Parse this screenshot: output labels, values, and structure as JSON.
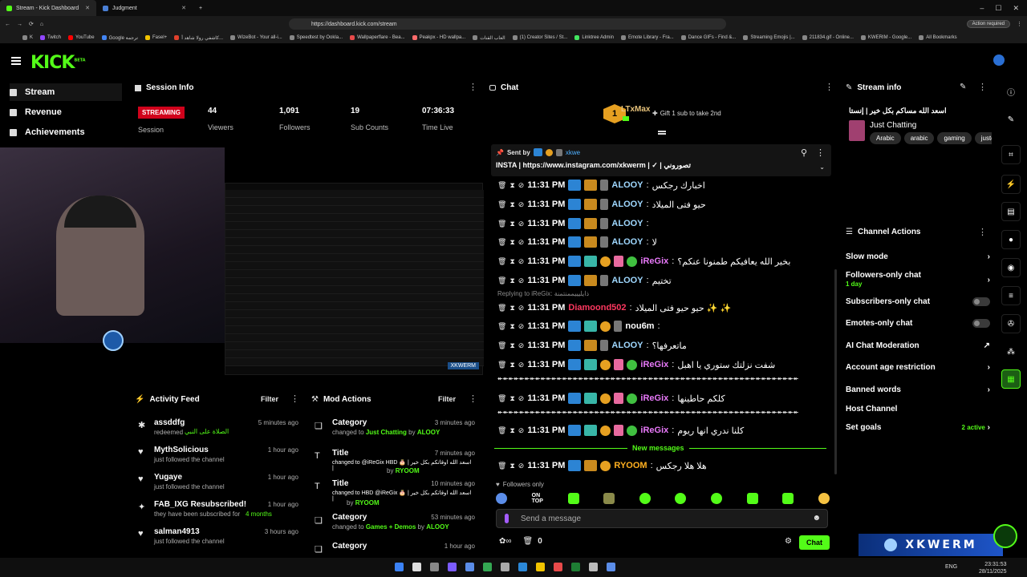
{
  "browser": {
    "tabs": [
      {
        "label": "Stream - Kick Dashboard",
        "active": true
      },
      {
        "label": "Judgment",
        "active": false
      }
    ],
    "url": "https://dashboard.kick.com/stream",
    "action_required": "Action required",
    "bookmarks": [
      "K",
      "Twitch",
      "YouTube",
      "Google ترجمة",
      "Fasel+",
      "كاشفي رولا شاهد أ...",
      "WizeBot - Your all-i...",
      "Speedtest by Ookla...",
      "Wallpaperflare - Bea...",
      "Peakpx - HD wallpa...",
      "العاب القنات",
      "(1) Creator Sites / St...",
      "Linktree Admin",
      "Emote Library - Fra...",
      "Dance GIFs - Find &...",
      "Streaming Emojis |...",
      "211834.gif - Online...",
      "KWERIM - Google...",
      "All Bookmarks"
    ]
  },
  "app": {
    "logo": "KICK",
    "logo_sup": "BETA",
    "nav": [
      {
        "label": "Stream",
        "active": true
      },
      {
        "label": "Revenue",
        "active": false
      },
      {
        "label": "Achievements",
        "active": false
      }
    ]
  },
  "session": {
    "title": "Session Info",
    "status": "STREAMING",
    "status_label": "Session",
    "stats": [
      {
        "value": "44",
        "label": "Viewers"
      },
      {
        "value": "1,091",
        "label": "Followers"
      },
      {
        "value": "19",
        "label": "Sub Counts"
      },
      {
        "value": "07:36:33",
        "label": "Time Live"
      }
    ]
  },
  "activity": {
    "title": "Activity Feed",
    "filter": "Filter",
    "items": [
      {
        "name": "assddfg",
        "sub": "redeemed",
        "extra": "الصلاة على النبي",
        "time": "5 minutes ago"
      },
      {
        "name": "MythSolicious",
        "sub": "just followed the channel",
        "extra": "",
        "time": "1 hour ago"
      },
      {
        "name": "Yugaye",
        "sub": "just followed the channel",
        "extra": "",
        "time": "1 hour ago"
      },
      {
        "name": "FAB_IXG Resubscribed!",
        "sub": "they have been subscribed for",
        "extra": "4 months",
        "time": "1 hour ago"
      },
      {
        "name": "salman4913",
        "sub": "just followed the channel",
        "extra": "",
        "time": "3 hours ago"
      }
    ]
  },
  "mod": {
    "title": "Mod Actions",
    "filter": "Filter",
    "items": [
      {
        "kind": "Category",
        "line": "changed to",
        "value": "Just Chatting",
        "by": "by",
        "user": "ALOOY",
        "time": "3 minutes ago"
      },
      {
        "kind": "Title",
        "line": "changed to @iReGix HBD 🎂 | اسعد الله اوقاتكم بكل خير |",
        "value": "",
        "by": "by",
        "user": "RYOOM",
        "time": "7 minutes ago"
      },
      {
        "kind": "Title",
        "line": "changed to HBD @iReGix 🎂 | اسعد الله اوقاتكم بكل خير |",
        "value": "",
        "by": "by",
        "user": "RYOOM",
        "time": "10 minutes ago"
      },
      {
        "kind": "Category",
        "line": "changed to",
        "value": "Games + Demos",
        "by": "by",
        "user": "ALOOY",
        "time": "53 minutes ago"
      },
      {
        "kind": "Category",
        "line": "",
        "value": "",
        "by": "",
        "user": "",
        "time": "1 hour ago"
      }
    ]
  },
  "chat": {
    "title": "Chat",
    "gifter": "LTxMax",
    "gifter_count": "1",
    "gift_text": "Gift 1 sub to take 2nd",
    "pinned_by_label": "Sent by",
    "pinned_by_user": "xkwe",
    "pinned_text": "INSTA | https://www.instagram.com/xkwerm | ✓ | تصوروني",
    "reply_note": "Replying to iReGix: ذايليييممنتمنة",
    "new_messages": "New messages",
    "followers_only": "Followers only",
    "input_placeholder": "Send a message",
    "send": "Chat",
    "count": "0",
    "messages": [
      {
        "time": "11:31 PM",
        "user": "ALOOY",
        "color": "#9fd8ff",
        "text": "اخبارك رجكس",
        "badges": [
          "blue",
          "crown",
          "kw"
        ]
      },
      {
        "time": "11:31 PM",
        "user": "ALOOY",
        "color": "#9fd8ff",
        "text": "حيو فتى الميلاد",
        "badges": [
          "blue",
          "crown",
          "kw"
        ]
      },
      {
        "time": "11:31 PM",
        "user": "ALOOY",
        "color": "#9fd8ff",
        "text": "",
        "badges": [
          "blue",
          "crown",
          "kw"
        ]
      },
      {
        "time": "11:31 PM",
        "user": "ALOOY",
        "color": "#9fd8ff",
        "text": "لا",
        "badges": [
          "blue",
          "crown",
          "kw"
        ]
      },
      {
        "time": "11:31 PM",
        "user": "iReGix",
        "color": "#e879f9",
        "text": "بخير الله يعافيكم طمنونا عنكم؟",
        "badges": [
          "blue",
          "teal",
          "gold",
          "pink",
          "ver"
        ]
      },
      {
        "time": "11:31 PM",
        "user": "ALOOY",
        "color": "#9fd8ff",
        "text": "تختيم",
        "badges": [
          "blue",
          "crown",
          "kw"
        ]
      },
      {
        "time": "11:31 PM",
        "user": "Diamoond502",
        "color": "#ff3860",
        "text": "حيو حيو فتى الميلاد ✨ ✨",
        "badges": []
      },
      {
        "time": "11:31 PM",
        "user": "nou6m",
        "color": "#ffffff",
        "text": "",
        "badges": [
          "blue",
          "teal",
          "gold",
          "kw"
        ]
      },
      {
        "time": "11:31 PM",
        "user": "ALOOY",
        "color": "#9fd8ff",
        "text": "ماتعرفها؟",
        "badges": [
          "blue",
          "crown",
          "kw"
        ]
      },
      {
        "time": "11:31 PM",
        "user": "iReGix",
        "color": "#e879f9",
        "text": "شفت نزلتك ستوري يا اهبل",
        "badges": [
          "blue",
          "teal",
          "gold",
          "pink",
          "ver"
        ]
      },
      {
        "time": "11:31 PM",
        "user": "iReGix",
        "color": "#e879f9",
        "text": "كلكم حاطينها",
        "badges": [
          "blue",
          "teal",
          "gold",
          "pink",
          "ver"
        ]
      },
      {
        "time": "11:31 PM",
        "user": "iReGix",
        "color": "#e879f9",
        "text": "كلنا ندري انها ريوم",
        "badges": [
          "blue",
          "teal",
          "gold",
          "pink",
          "ver"
        ]
      },
      {
        "time": "11:31 PM",
        "user": "RYOOM",
        "color": "#ffb020",
        "text": "هلا هلا رجكس",
        "badges": [
          "blue",
          "crown",
          "gold"
        ]
      }
    ],
    "arrows_line": "↞↞↞↞↞↞↞↞↞↞↞↞↞↞↞↞↞↞↞↞↞↞↞↞↞↞↞↞↞↞↞↞↞↞↞↞↞↞↞↞↞↞↞↞↞↞↞↞↞↞↞↞↞↞↞↞"
  },
  "stream_info": {
    "title": "Stream info",
    "stream_title": "اسعد الله مساكم بكل خير | إنستا",
    "category": "Just Chatting",
    "tags": [
      "Arabic",
      "arabic",
      "gaming",
      "justch"
    ]
  },
  "channel_actions": {
    "title": "Channel Actions",
    "items": [
      {
        "label": "Slow mode",
        "sub": "",
        "control": "chevron"
      },
      {
        "label": "Followers-only chat",
        "sub": "1 day",
        "control": "chevron"
      },
      {
        "label": "Subscribers-only chat",
        "sub": "",
        "control": "toggle"
      },
      {
        "label": "Emotes-only chat",
        "sub": "",
        "control": "toggle"
      },
      {
        "label": "AI Chat Moderation",
        "sub": "",
        "control": "external"
      },
      {
        "label": "Account age restriction",
        "sub": "",
        "control": "chevron"
      },
      {
        "label": "Banned words",
        "sub": "",
        "control": "chevron"
      },
      {
        "label": "Host Channel",
        "sub": "",
        "control": "none"
      },
      {
        "label": "Set goals",
        "sub": "2 active",
        "control": "chevron"
      }
    ]
  },
  "overlay": {
    "banner": "XKWERM"
  },
  "taskbar": {
    "lang": "ENG",
    "time": "23:31:53",
    "date": "28/11/2025"
  },
  "colors": {
    "brand": "#53fc18",
    "streaming": "#d0021b"
  }
}
